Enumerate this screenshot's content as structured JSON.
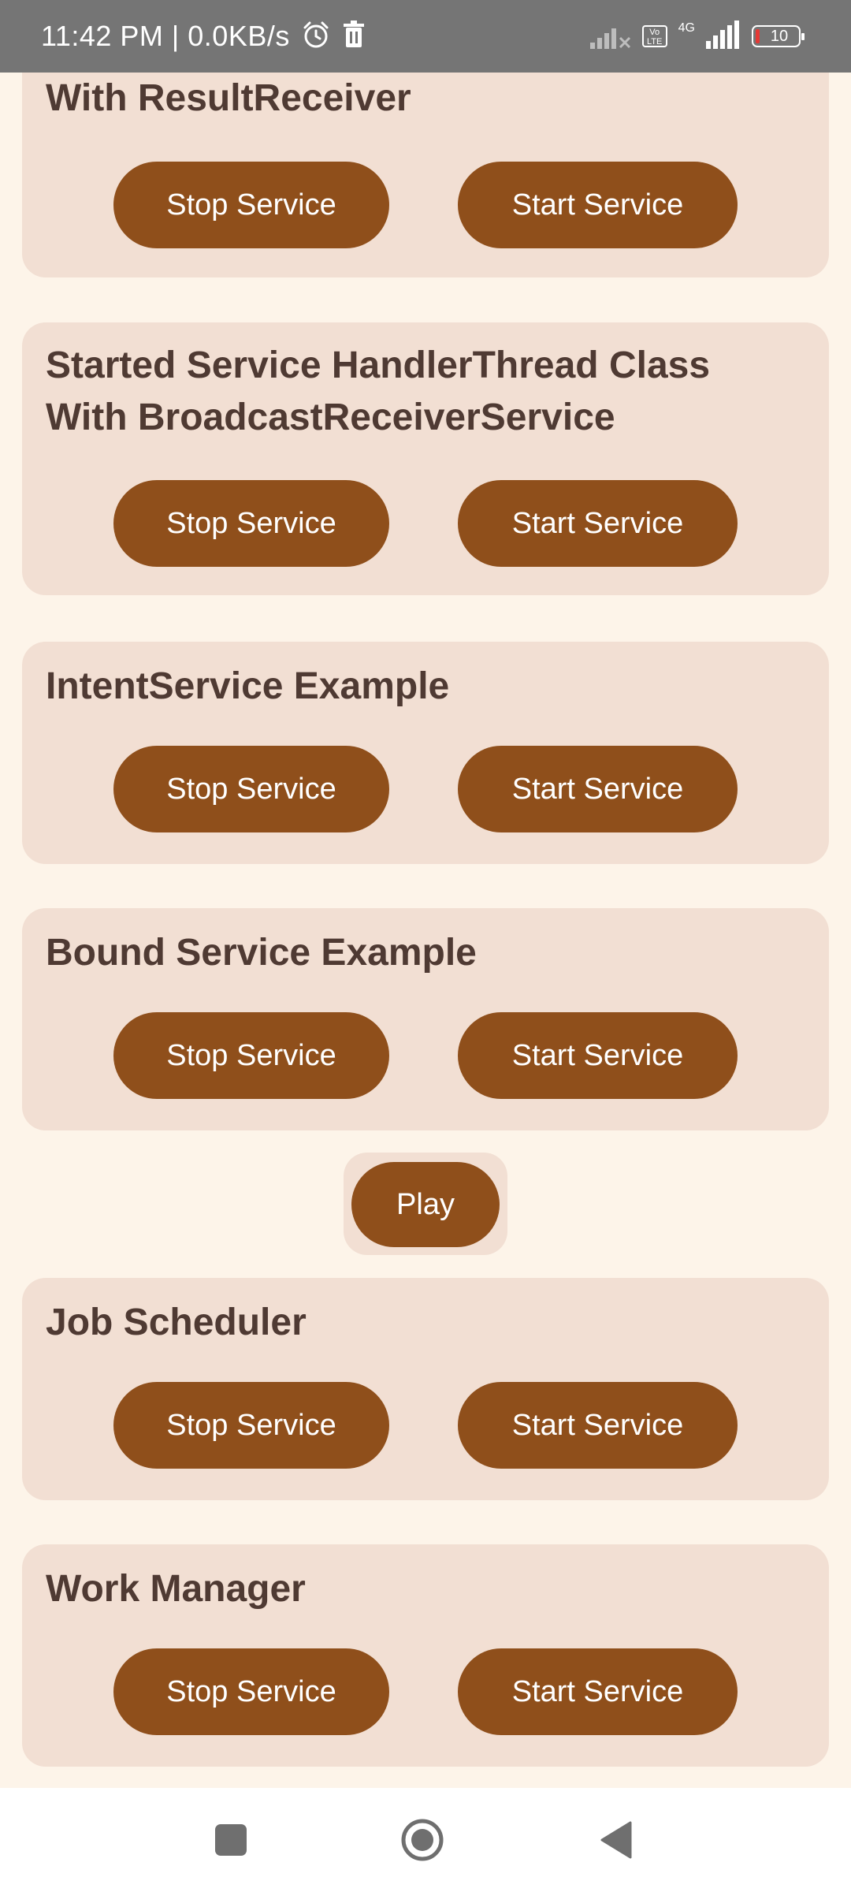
{
  "status_bar": {
    "time_speed": "11:42 PM | 0.0KB/s",
    "volte_label": "Vo LTE",
    "network_label": "4G",
    "battery_level": "10",
    "icons": [
      "alarm-icon",
      "delete-icon",
      "signal-icon",
      "volte-icon",
      "battery-icon"
    ]
  },
  "cards": [
    {
      "title": "With ResultReceiver",
      "stop_label": "Stop Service",
      "start_label": "Start Service"
    },
    {
      "title_line1": "Started Service HandlerThread Class",
      "title_line2": "With BroadcastReceiverService",
      "stop_label": "Stop Service",
      "start_label": "Start Service"
    },
    {
      "title": "IntentService Example",
      "stop_label": "Stop Service",
      "start_label": "Start Service"
    },
    {
      "title": "Bound Service Example",
      "stop_label": "Stop Service",
      "start_label": "Start Service"
    },
    {
      "title": "Job Scheduler",
      "stop_label": "Stop Service",
      "start_label": "Start Service"
    },
    {
      "title": "Work Manager",
      "stop_label": "Stop Service",
      "start_label": "Start Service"
    }
  ],
  "play_label": "Play",
  "nav_bar": {
    "icons": [
      "recents-square-icon",
      "home-circle-icon",
      "back-triangle-icon"
    ]
  },
  "colors": {
    "background": "#fdf4e9",
    "card": "#f2dfd3",
    "button": "#8f4f1b",
    "title_text": "#4f3a33",
    "status_bar": "#757575"
  }
}
